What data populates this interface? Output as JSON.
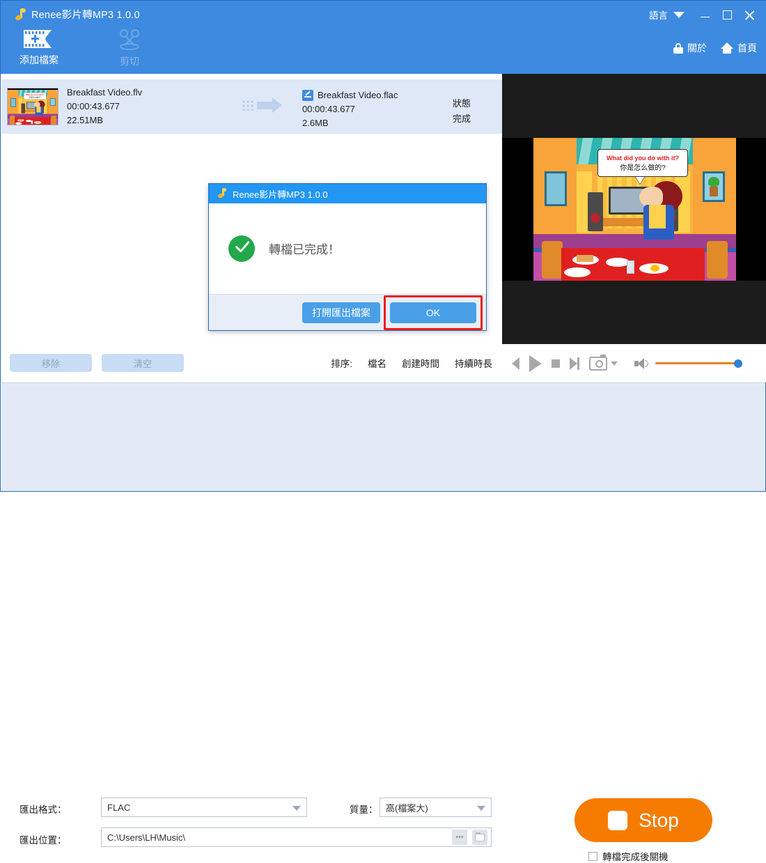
{
  "window": {
    "title": "Renee影片轉MP3 1.0.0",
    "language_label": "語言",
    "minimize": "—",
    "maximize": "□",
    "close": "×"
  },
  "header_links": {
    "about": "關於",
    "home": "首頁"
  },
  "toolbar": {
    "add_file": "添加檔案",
    "cut": "剪切"
  },
  "file_row": {
    "source_name": "Breakfast Video.flv",
    "source_duration": "00:00:43.677",
    "source_size": "22.51MB",
    "target_name": "Breakfast Video.flac",
    "target_duration": "00:00:43.677",
    "target_size": "2.6MB",
    "status_header": "狀態",
    "status_value": "完成"
  },
  "list_actions": {
    "remove": "移除",
    "clear": "清空",
    "sort_label": "排序:",
    "sort_by_name": "檔名",
    "sort_by_created": "創建時間",
    "sort_by_duration": "持續時長"
  },
  "player": {
    "previous": "previous",
    "play": "play",
    "stop": "stop",
    "next": "next",
    "snapshot": "snapshot",
    "volume": "volume",
    "volume_level": 100
  },
  "preview": {
    "bubble_en": "What did you do with it?",
    "bubble_zh": "你是怎么做的?"
  },
  "settings": {
    "format_label": "匯出格式：",
    "format_value": "FLAC",
    "quality_label": "質量：",
    "quality_value": "高(檔案大)",
    "location_label": "匯出位置：",
    "location_value": "C:\\Users\\LH\\Music\\",
    "browse_dots": "•••"
  },
  "action": {
    "stop_label": "Stop",
    "shutdown_label": "轉檔完成後關機"
  },
  "dialog": {
    "title": "Renee影片轉MP3 1.0.0",
    "message": "轉檔已完成！",
    "open_output": "打開匯出檔案",
    "ok": "OK"
  },
  "colors": {
    "brand_blue": "#3d8ae0",
    "dialog_blue": "#2196f3",
    "accent_orange": "#f57c00",
    "success_green": "#21a94a",
    "highlight_red": "#ee1c1c"
  }
}
